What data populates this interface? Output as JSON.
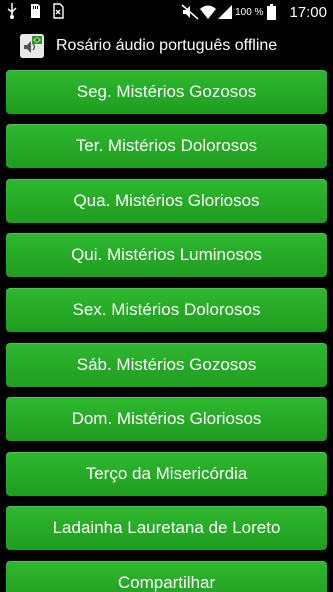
{
  "status_bar": {
    "left_icons": [
      "usb-icon",
      "sd-card-icon",
      "download-icon"
    ],
    "right_icons": [
      "mute-icon",
      "wifi-icon",
      "signal-icon",
      "battery-icon"
    ],
    "battery_percent": "100 %",
    "time": "17:00"
  },
  "app_bar": {
    "icon": "rosary-audio-app-icon",
    "title": "Rosário áudio português offline"
  },
  "colors": {
    "button_green": "#22a822",
    "background": "#000000",
    "text": "#ffffff"
  },
  "menu": {
    "items": [
      {
        "label": "Seg. Mistérios Gozosos"
      },
      {
        "label": "Ter. Mistérios Dolorosos"
      },
      {
        "label": "Qua. Mistérios Gloriosos"
      },
      {
        "label": "Qui. Mistérios Luminosos"
      },
      {
        "label": "Sex. Mistérios Dolorosos"
      },
      {
        "label": "Sáb. Mistérios Gozosos"
      },
      {
        "label": "Dom. Mistérios Gloriosos"
      },
      {
        "label": "Terço da Misericórdia"
      },
      {
        "label": "Ladainha Lauretana de Loreto"
      },
      {
        "label": "Compartilhar"
      }
    ]
  }
}
